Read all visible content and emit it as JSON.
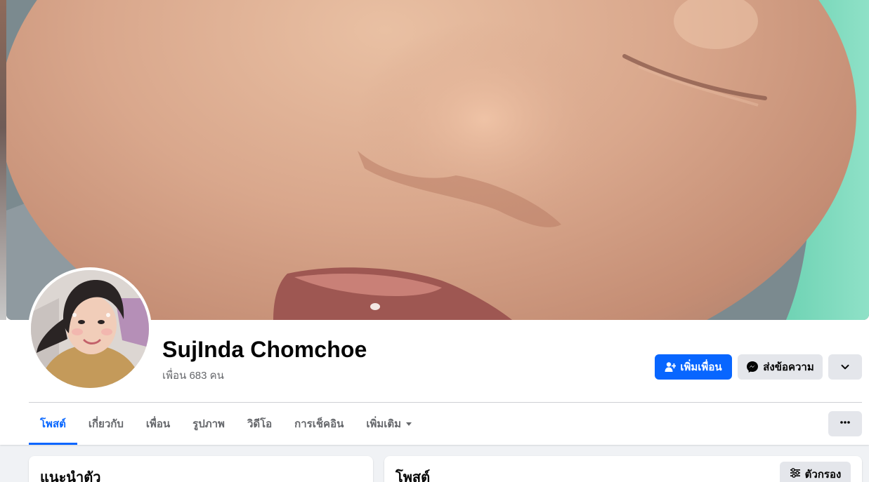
{
  "profile": {
    "name": "SujInda Chomchoe",
    "friend_count_text": "เพื่อน 683 คน"
  },
  "actions": {
    "add_friend_label": "เพิ่มเพื่อน",
    "message_label": "ส่งข้อความ"
  },
  "tabs": [
    {
      "label": "โพสต์",
      "active": true
    },
    {
      "label": "เกี่ยวกับ",
      "active": false
    },
    {
      "label": "เพื่อน",
      "active": false
    },
    {
      "label": "รูปภาพ",
      "active": false
    },
    {
      "label": "วิดีโอ",
      "active": false
    },
    {
      "label": "การเช็คอิน",
      "active": false
    },
    {
      "label": "เพิ่มเติม",
      "active": false
    }
  ],
  "intro_card": {
    "title": "แนะนำตัว"
  },
  "posts_card": {
    "title": "โพสต์",
    "filter_label": "ตัวกรอง"
  },
  "colors": {
    "accent": "#0866ff",
    "secondary_button": "#e4e6eb",
    "muted_text": "#65676b",
    "background": "#f0f2f5"
  },
  "icons": {
    "add_friend": "person-plus-icon",
    "message": "messenger-icon",
    "expand": "chevron-down-icon",
    "more": "ellipsis-icon",
    "more_tab": "caret-down-icon",
    "filter": "sliders-icon"
  }
}
